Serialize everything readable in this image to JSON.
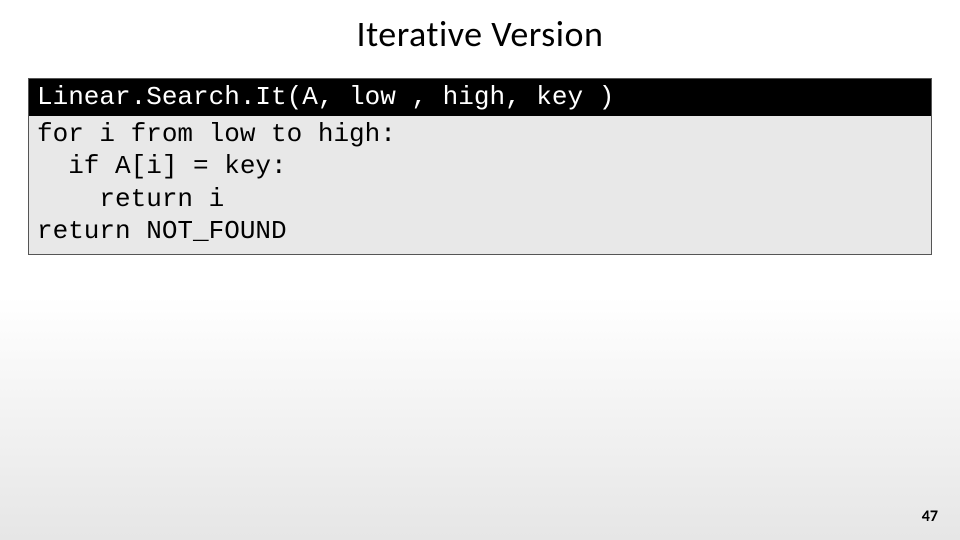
{
  "slide": {
    "title": "Iterative Version",
    "page_number": "47"
  },
  "code": {
    "signature": "Linear.Search.It(A, low , high, key )",
    "body": "for i from low to high:\n  if A[i] = key:\n    return i\nreturn NOT_FOUND"
  }
}
